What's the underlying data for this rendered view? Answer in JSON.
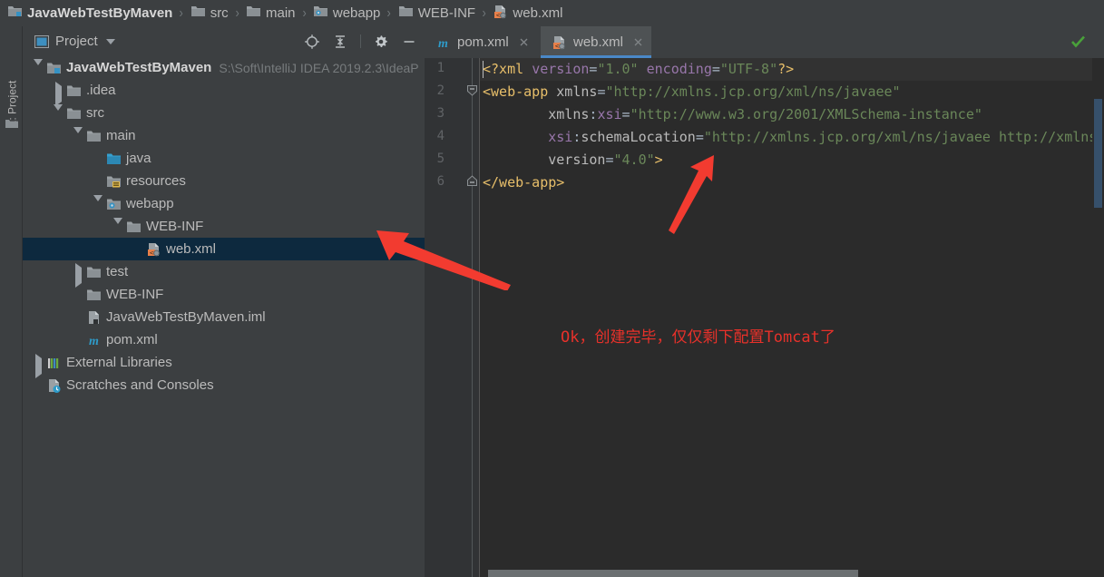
{
  "breadcrumb": {
    "separator": "›",
    "items": [
      {
        "label": "JavaWebTestByMaven",
        "icon": "module-folder-icon"
      },
      {
        "label": "src",
        "icon": "folder-icon"
      },
      {
        "label": "main",
        "icon": "folder-icon"
      },
      {
        "label": "webapp",
        "icon": "webapp-folder-icon"
      },
      {
        "label": "WEB-INF",
        "icon": "folder-icon"
      },
      {
        "label": "web.xml",
        "icon": "xml-file-icon"
      }
    ]
  },
  "tool_strip": {
    "project_tab": "1: Project",
    "icon": "folder-icon"
  },
  "project_panel": {
    "title": "Project",
    "title_icon": "project-view-icon",
    "tools": [
      {
        "name": "locate-icon",
        "title": "Select Opened File"
      },
      {
        "name": "collapse-all-icon",
        "title": "Collapse All"
      },
      {
        "name": "gear-icon",
        "title": "Settings"
      },
      {
        "name": "minimize-icon",
        "title": "Hide"
      }
    ],
    "tree": [
      {
        "label": "JavaWebTestByMaven",
        "path": "S:\\Soft\\IntelliJ IDEA 2019.2.3\\IdeaP",
        "depth": 0,
        "twisty": "down",
        "icon": "module-folder-icon",
        "bold": true,
        "selected": false
      },
      {
        "label": ".idea",
        "path": "",
        "depth": 1,
        "twisty": "right",
        "icon": "folder-icon",
        "bold": false,
        "selected": false
      },
      {
        "label": "src",
        "path": "",
        "depth": 1,
        "twisty": "down",
        "icon": "folder-icon",
        "bold": false,
        "selected": false
      },
      {
        "label": "main",
        "path": "",
        "depth": 2,
        "twisty": "down",
        "icon": "folder-icon",
        "bold": false,
        "selected": false
      },
      {
        "label": "java",
        "path": "",
        "depth": 3,
        "twisty": "none",
        "icon": "source-folder-icon",
        "bold": false,
        "selected": false
      },
      {
        "label": "resources",
        "path": "",
        "depth": 3,
        "twisty": "none",
        "icon": "resources-folder-icon",
        "bold": false,
        "selected": false
      },
      {
        "label": "webapp",
        "path": "",
        "depth": 3,
        "twisty": "down",
        "icon": "webapp-folder-icon",
        "bold": false,
        "selected": false
      },
      {
        "label": "WEB-INF",
        "path": "",
        "depth": 4,
        "twisty": "down",
        "icon": "folder-icon",
        "bold": false,
        "selected": false
      },
      {
        "label": "web.xml",
        "path": "",
        "depth": 5,
        "twisty": "none",
        "icon": "xml-file-icon",
        "bold": false,
        "selected": true
      },
      {
        "label": "test",
        "path": "",
        "depth": 2,
        "twisty": "right",
        "icon": "folder-icon",
        "bold": false,
        "selected": false
      },
      {
        "label": "WEB-INF",
        "path": "",
        "depth": 2,
        "twisty": "none",
        "icon": "folder-icon",
        "bold": false,
        "selected": false
      },
      {
        "label": "JavaWebTestByMaven.iml",
        "path": "",
        "depth": 2,
        "twisty": "none",
        "icon": "iml-file-icon",
        "bold": false,
        "selected": false
      },
      {
        "label": "pom.xml",
        "path": "",
        "depth": 2,
        "twisty": "none",
        "icon": "maven-file-icon",
        "bold": false,
        "selected": false
      },
      {
        "label": "External Libraries",
        "path": "",
        "depth": 0,
        "twisty": "right",
        "icon": "libraries-icon",
        "bold": false,
        "selected": false
      },
      {
        "label": "Scratches and Consoles",
        "path": "",
        "depth": 0,
        "twisty": "none",
        "icon": "scratches-icon",
        "bold": false,
        "selected": false
      }
    ]
  },
  "editor": {
    "tabs": [
      {
        "label": "pom.xml",
        "icon": "maven-file-icon",
        "active": false,
        "close_icon": "close-icon"
      },
      {
        "label": "web.xml",
        "icon": "xml-file-icon",
        "active": true,
        "close_icon": "close-icon"
      }
    ],
    "line_numbers": [
      "1",
      "2",
      "3",
      "4",
      "5",
      "6"
    ],
    "lines": [
      {
        "num": "1",
        "segments": [
          {
            "text": "<?xml ",
            "cls": "c-tag"
          },
          {
            "text": "version",
            "cls": "c-attr"
          },
          {
            "text": "=",
            "cls": "c-punc"
          },
          {
            "text": "\"1.0\"",
            "cls": "c-val"
          },
          {
            "text": " ",
            "cls": "c-punc"
          },
          {
            "text": "encoding",
            "cls": "c-attr"
          },
          {
            "text": "=",
            "cls": "c-punc"
          },
          {
            "text": "\"UTF-8\"",
            "cls": "c-val"
          },
          {
            "text": "?>",
            "cls": "c-tag"
          }
        ]
      },
      {
        "num": "2",
        "segments": [
          {
            "text": "<web-app ",
            "cls": "c-tag"
          },
          {
            "text": "xmlns",
            "cls": "c-attr2"
          },
          {
            "text": "=",
            "cls": "c-punc"
          },
          {
            "text": "\"http://xmlns.jcp.org/xml/ns/javaee\"",
            "cls": "c-val"
          }
        ]
      },
      {
        "num": "3",
        "segments": [
          {
            "text": "        ",
            "cls": "c-punc"
          },
          {
            "text": "xmlns",
            "cls": "c-attr2"
          },
          {
            "text": ":",
            "cls": "c-punc"
          },
          {
            "text": "xsi",
            "cls": "c-attr"
          },
          {
            "text": "=",
            "cls": "c-punc"
          },
          {
            "text": "\"http://www.w3.org/2001/XMLSchema-instance\"",
            "cls": "c-val"
          }
        ]
      },
      {
        "num": "4",
        "segments": [
          {
            "text": "        ",
            "cls": "c-punc"
          },
          {
            "text": "xsi",
            "cls": "c-attr"
          },
          {
            "text": ":",
            "cls": "c-punc"
          },
          {
            "text": "schemaLocation",
            "cls": "c-attr2"
          },
          {
            "text": "=",
            "cls": "c-punc"
          },
          {
            "text": "\"http://xmlns.jcp.org/xml/ns/javaee http://xmlns",
            "cls": "c-val"
          }
        ]
      },
      {
        "num": "5",
        "segments": [
          {
            "text": "        ",
            "cls": "c-punc"
          },
          {
            "text": "version",
            "cls": "c-attr2"
          },
          {
            "text": "=",
            "cls": "c-punc"
          },
          {
            "text": "\"4.0\"",
            "cls": "c-val"
          },
          {
            "text": ">",
            "cls": "c-tag"
          }
        ]
      },
      {
        "num": "6",
        "segments": [
          {
            "text": "</web-app>",
            "cls": "c-tag"
          }
        ]
      }
    ],
    "inspection_status": "ok-check-icon",
    "annotation": "Ok，创建完毕，仅仅剩下配置Tomcat了"
  },
  "annotations": {
    "arrow_to_webxml": "red-arrow-left",
    "arrow_to_version": "red-arrow-up-right"
  },
  "colors": {
    "panel_bg": "#3c3f41",
    "editor_bg": "#2b2b2b",
    "gutter_bg": "#313335",
    "selection_bg": "#0d293e",
    "tab_active_bg": "#4e5254",
    "tab_underline": "#4a88c7",
    "annotation_red": "#e8312a",
    "ok_green": "#49a13a",
    "tag_orange": "#e8bf6a",
    "string_green": "#6a8759",
    "attr_purple": "#9876aa"
  }
}
